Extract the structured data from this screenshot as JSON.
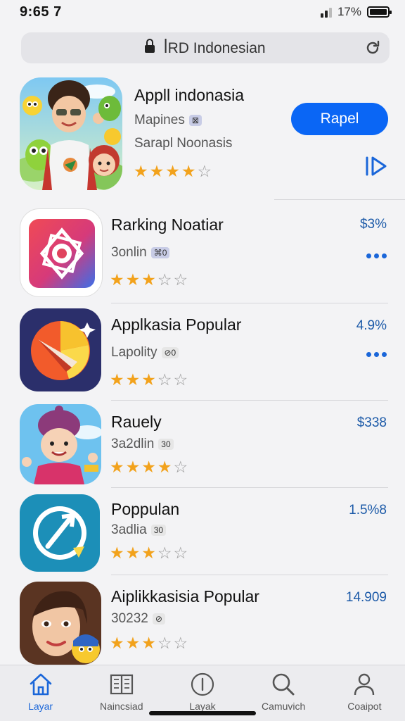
{
  "status_bar": {
    "time": "9:65 7",
    "battery": "17%"
  },
  "address_bar": {
    "text": "ꟾRD Indonesian"
  },
  "featured": {
    "title": "Appll indonasia",
    "subtitle": "Mapines",
    "subtitle_badge": "⊠",
    "developer": "Sarapl Noonasis",
    "rating": 4,
    "get_label": "Rapel",
    "icon": "cartoon-characters-icon"
  },
  "apps": [
    {
      "title": "Rarking Noatiar",
      "sub": "3onlin",
      "sub_badge": "⌘0",
      "rating": 3,
      "value": "$3%",
      "has_more": true,
      "icon": "gear-badge-icon"
    },
    {
      "title": "Applkasia Popular",
      "sub": "Lapolity",
      "sub_badge": "⊘0",
      "rating": 3,
      "value": "4.9%",
      "has_more": true,
      "icon": "pie-compass-icon"
    },
    {
      "title": "Rauely",
      "sub": "3a2dlin",
      "sub_badge": "30",
      "rating": 4,
      "value": "$338",
      "has_more": false,
      "icon": "cartoon-boy-icon"
    },
    {
      "title": "Poppulan",
      "sub": "3adlia",
      "sub_badge": "30",
      "rating": 3,
      "value": "1.5%8",
      "has_more": false,
      "icon": "arrow-circle-icon"
    },
    {
      "title": "Aiplikkasisia Popular",
      "sub": "30232",
      "sub_badge": "⊘",
      "rating": 3,
      "value": "14.909",
      "has_more": false,
      "icon": "cartoon-girl-icon"
    }
  ],
  "tabs": [
    {
      "label": "Layar",
      "icon": "home-icon",
      "active": true
    },
    {
      "label": "Naincsiad",
      "icon": "book-icon",
      "active": false
    },
    {
      "label": "Layak",
      "icon": "info-circle-icon",
      "active": false
    },
    {
      "label": "Camuvich",
      "icon": "search-icon",
      "active": false
    },
    {
      "label": "Coaipot",
      "icon": "person-icon",
      "active": false
    }
  ],
  "colors": {
    "accent": "#0a66f5",
    "star": "#f2a21c",
    "value_text": "#1c5aa8",
    "background": "#f3f3f5"
  }
}
